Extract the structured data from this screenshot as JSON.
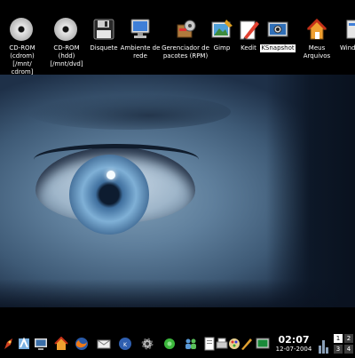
{
  "desktop_icons": [
    {
      "label": "CD-ROM\n(cdrom) [/mnt/\ncdrom]",
      "icon": "cdrom-icon"
    },
    {
      "label": "CD-ROM (hdd)\n[/mnt/dvd]",
      "icon": "cdrom-icon"
    },
    {
      "label": "Disquete",
      "icon": "floppy-icon"
    },
    {
      "label": "Ambiente de\nrede",
      "icon": "network-monitor-icon"
    },
    {
      "label": "Gerenciador de\npacotes (RPM)",
      "icon": "package-manager-icon"
    },
    {
      "label": "Gimp",
      "icon": "gimp-icon"
    },
    {
      "label": "Kedit",
      "icon": "kedit-icon"
    },
    {
      "label": "KSnapshot",
      "icon": "camera-icon"
    },
    {
      "label": "Meus Arquivos",
      "icon": "home-icon"
    },
    {
      "label": "Wind",
      "icon": "window-icon"
    }
  ],
  "panel": {
    "launchers": [
      "rocket-icon",
      "konqueror-icon",
      "monitor-icon",
      "home-icon",
      "firefox-icon",
      "mail-icon",
      "kde-icon",
      "gear-icon",
      "users-icon",
      "document-icon",
      "printer-icon",
      "paint-icon",
      "terminal-icon"
    ],
    "clock": {
      "time": "02:07",
      "date": "12-07-2004"
    },
    "pager": {
      "desktops": [
        "1",
        "2",
        "3",
        "4"
      ],
      "active": "1"
    }
  },
  "colors": {
    "selection_bg": "#ffffff",
    "panel_bg": "#000000",
    "wallpaper_tint": "#5f7f9c"
  }
}
